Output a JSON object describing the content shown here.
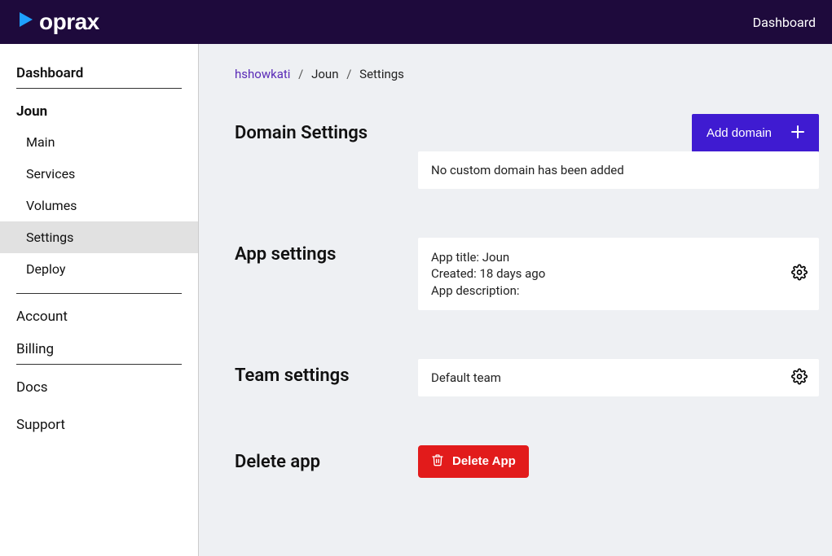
{
  "brand": "oprax",
  "topnav": {
    "dashboard": "Dashboard"
  },
  "sidebar": {
    "dashboard": "Dashboard",
    "app_name": "Joun",
    "items": [
      {
        "label": "Main"
      },
      {
        "label": "Services"
      },
      {
        "label": "Volumes"
      },
      {
        "label": "Settings"
      },
      {
        "label": "Deploy"
      }
    ],
    "account": "Account",
    "billing": "Billing",
    "docs": "Docs",
    "support": "Support"
  },
  "breadcrumb": {
    "user": "hshowkati",
    "app": "Joun",
    "page": "Settings"
  },
  "sections": {
    "domain": {
      "title": "Domain Settings",
      "add_button": "Add domain",
      "empty": "No custom domain has been added"
    },
    "app": {
      "title": "App settings",
      "line1": "App title: Joun",
      "line2": "Created: 18 days ago",
      "line3": "App description:"
    },
    "team": {
      "title": "Team settings",
      "line": "Default team"
    },
    "delete": {
      "title": "Delete app",
      "button": "Delete App"
    }
  }
}
